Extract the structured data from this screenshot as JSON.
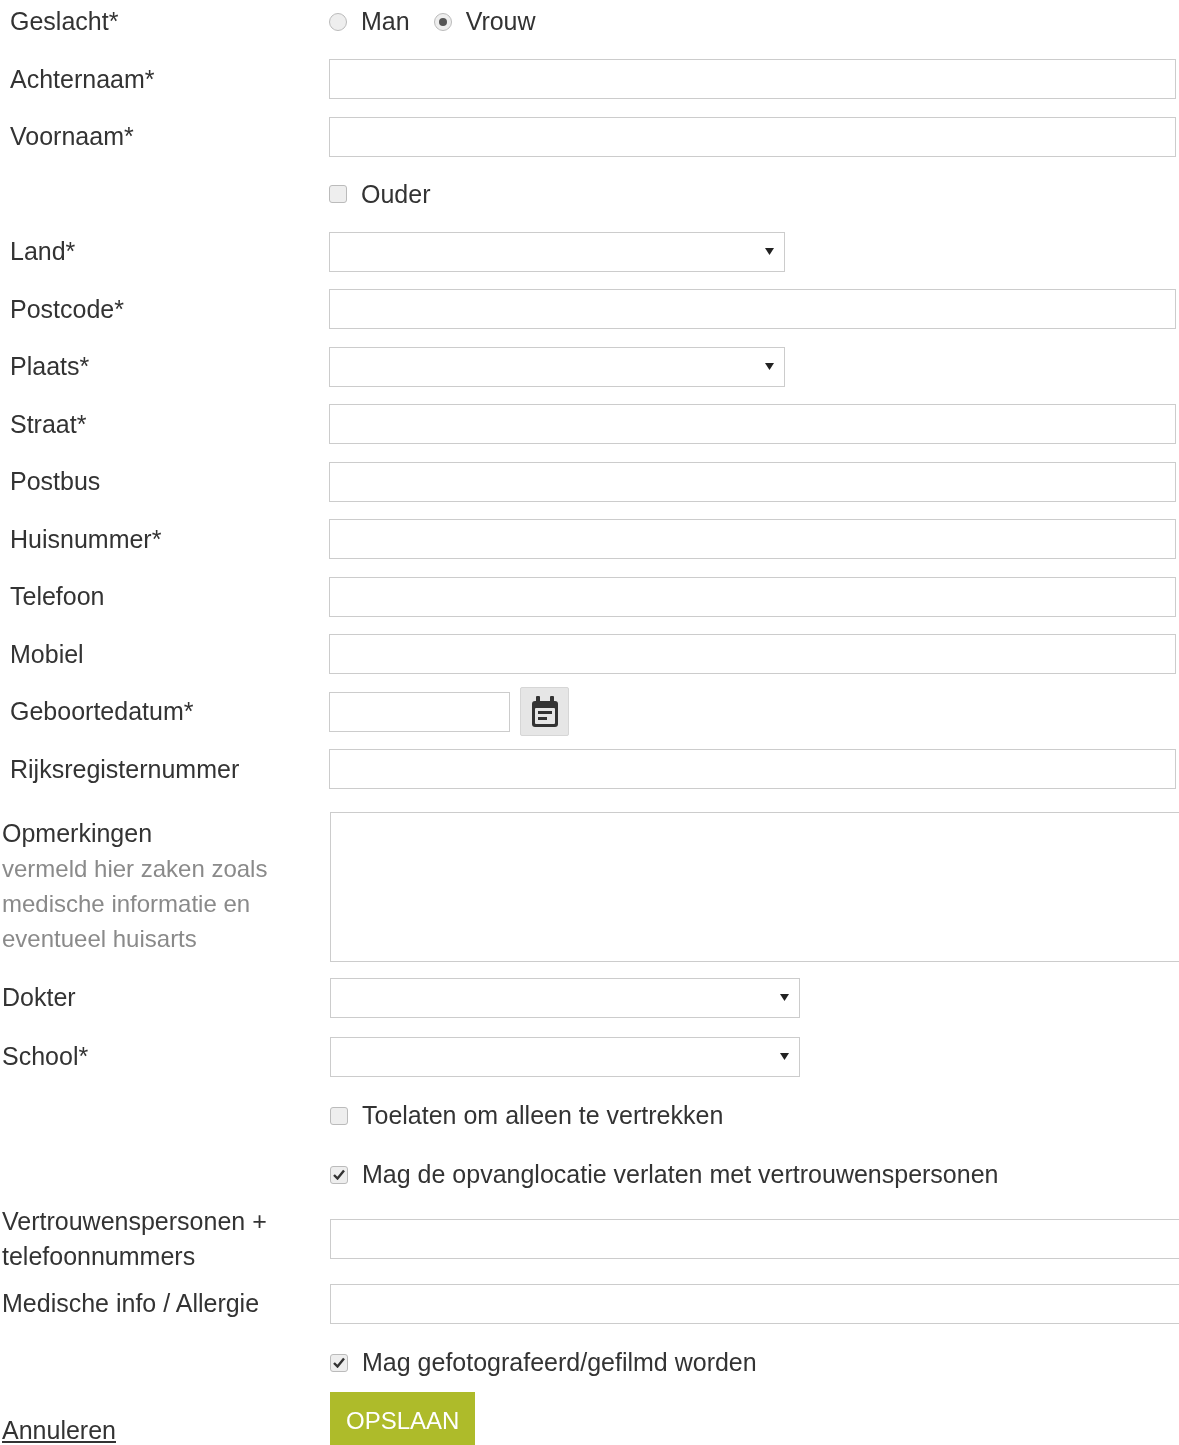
{
  "fields": [
    {
      "kind": "radio",
      "label": "Geslacht*",
      "options": [
        {
          "label": "Man",
          "selected": false
        },
        {
          "label": "Vrouw",
          "selected": true
        }
      ]
    },
    {
      "kind": "text",
      "label": "Achternaam*"
    },
    {
      "kind": "text",
      "label": "Voornaam*"
    },
    {
      "kind": "checkbox",
      "label": "Ouder",
      "checked": false
    },
    {
      "kind": "select",
      "label": "Land*"
    },
    {
      "kind": "text",
      "label": "Postcode*"
    },
    {
      "kind": "select",
      "label": "Plaats*"
    },
    {
      "kind": "text",
      "label": "Straat*"
    },
    {
      "kind": "text",
      "label": "Postbus"
    },
    {
      "kind": "text",
      "label": "Huisnummer*"
    },
    {
      "kind": "text",
      "label": "Telefoon"
    },
    {
      "kind": "text",
      "label": "Mobiel"
    },
    {
      "kind": "date",
      "label": "Geboortedatum*"
    },
    {
      "kind": "text",
      "label": "Rijksregisternummer"
    }
  ],
  "extra_fields": [
    {
      "kind": "textarea",
      "label": "Opmerkingen",
      "hint": "vermeld hier zaken zoals medische informatie en eventueel huisarts"
    },
    {
      "kind": "select",
      "label": "Dokter"
    },
    {
      "kind": "select",
      "label": "School*"
    },
    {
      "kind": "checkbox",
      "label": "Toelaten om alleen te vertrekken",
      "checked": false
    },
    {
      "kind": "checkbox",
      "label": "Mag de opvanglocatie verlaten met vertrouwenspersonen",
      "checked": true
    },
    {
      "kind": "text",
      "label": "Vertrouwenspersonen + telefoonnummers"
    },
    {
      "kind": "text",
      "label": "Medische info / Allergie"
    },
    {
      "kind": "checkbox",
      "label": "Mag gefotografeerd/gefilmd worden",
      "checked": true
    }
  ],
  "cancel_link": "Annuleren",
  "save_button": "OPSLAAN"
}
